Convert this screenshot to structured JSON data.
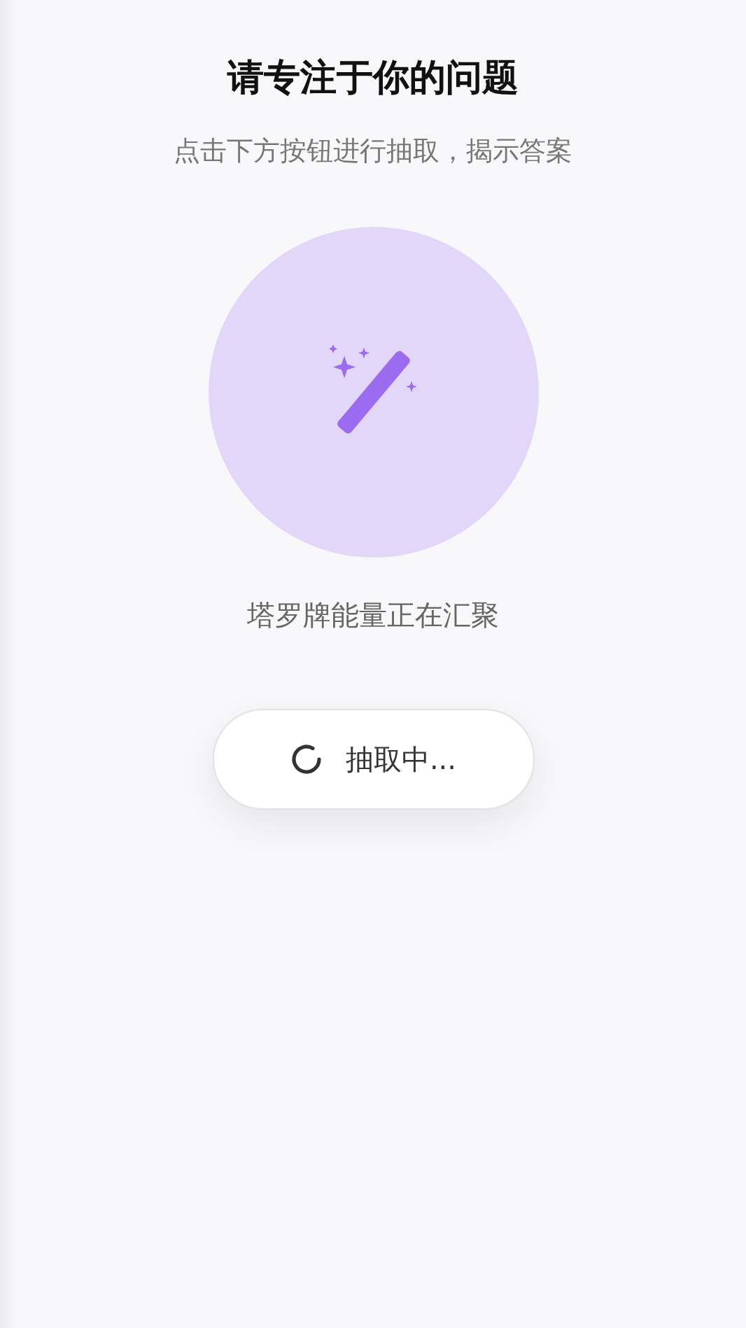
{
  "header": {
    "title": "请专注于你的问题",
    "subtitle": "点击下方按钮进行抽取，揭示答案"
  },
  "status": {
    "text": "塔罗牌能量正在汇聚"
  },
  "draw_button": {
    "label": "抽取中...",
    "loading": true
  }
}
